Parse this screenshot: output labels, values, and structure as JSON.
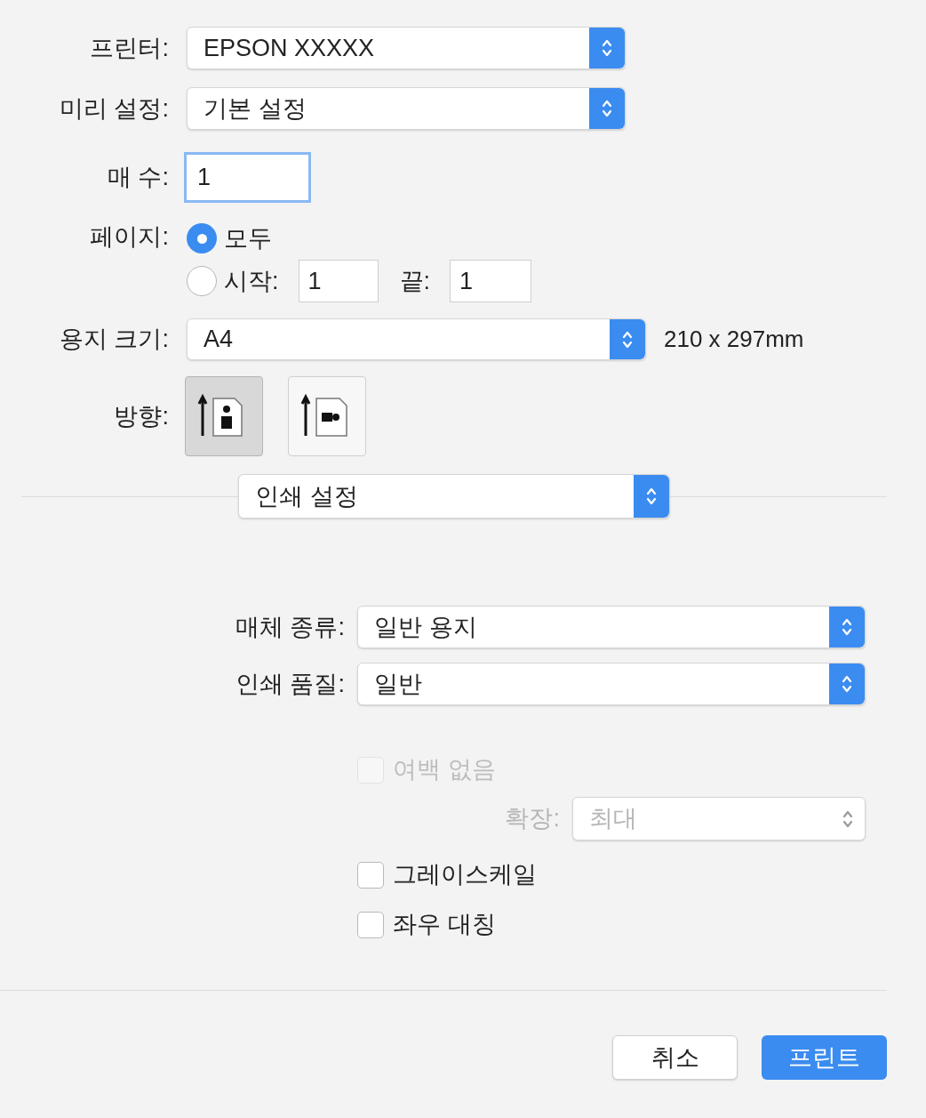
{
  "printer": {
    "label": "프린터:",
    "value": "EPSON XXXXX"
  },
  "preset": {
    "label": "미리 설정:",
    "value": "기본 설정"
  },
  "copies": {
    "label": "매 수:",
    "value": "1",
    "focused": true
  },
  "pages": {
    "label": "페이지:",
    "options": [
      {
        "label": "모두",
        "selected": true
      },
      {
        "label": "시작:",
        "selected": false
      }
    ],
    "from": "1",
    "to_label": "끝:",
    "to": "1"
  },
  "paper_size": {
    "label": "용지 크기:",
    "value": "A4",
    "dimensions": "210 x 297mm"
  },
  "orientation": {
    "label": "방향:",
    "options": [
      {
        "kind": "portrait",
        "selected": true
      },
      {
        "kind": "landscape",
        "selected": false
      }
    ]
  },
  "section_menu": {
    "value": "인쇄 설정"
  },
  "media_type": {
    "label": "매체 종류:",
    "value": "일반 용지"
  },
  "print_quality": {
    "label": "인쇄 품질:",
    "value": "일반"
  },
  "borderless": {
    "label": "여백 없음",
    "checked": false,
    "disabled": true
  },
  "expansion": {
    "label": "확장:",
    "value": "최대",
    "disabled": true
  },
  "options": [
    {
      "label": "그레이스케일",
      "checked": false,
      "disabled": false
    },
    {
      "label": "좌우 대칭",
      "checked": false,
      "disabled": false
    }
  ],
  "buttons": [
    {
      "label": "취소",
      "kind": "secondary"
    },
    {
      "label": "프린트",
      "kind": "primary"
    }
  ]
}
